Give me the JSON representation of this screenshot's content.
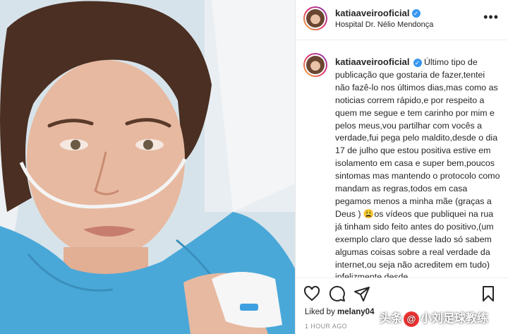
{
  "post": {
    "username": "katiaaveirooficial",
    "location": "Hospital Dr. Nélio Mendonça",
    "more_icon": "more-horizontal-icon",
    "caption": "Último tipo de publicação que gostaria de fazer,tentei não fazê-lo nos últimos dias,mas como as noticias correm rápido,e por respeito a quem me segue e tem carinho por mim e pelos meus,vou partilhar com vocês a verdade,fui pega pelo maldito,desde o dia 17 de julho que estou positiva estive em isolamento em casa e super bem,poucos sintomas mas mantendo o protocolo como mandam as regras,todos em casa pegamos menos a minha mãe (graças a Deus ) 😩os vídeos que publiquei na rua já tinham sido feito antes do positivo,(um exemplo claro que desse lado só sabem algumas coisas sobre a real verdade da internet,ou seja não acreditem em tudo) infelizmente desde",
    "liked_prefix": "Liked by",
    "liked_user": "melany04",
    "time": "1 HOUR AGO"
  },
  "actions": {
    "like_icon": "heart-icon",
    "comment_icon": "comment-icon",
    "share_icon": "send-icon",
    "save_icon": "bookmark-icon"
  },
  "watermark": {
    "text_prefix": "头条",
    "badge": "@",
    "text_suffix": "小刘足球教练"
  },
  "colors": {
    "verified": "#3897f0",
    "text": "#262626",
    "muted": "#8e8e8e",
    "gown": "#4aa8d8"
  }
}
